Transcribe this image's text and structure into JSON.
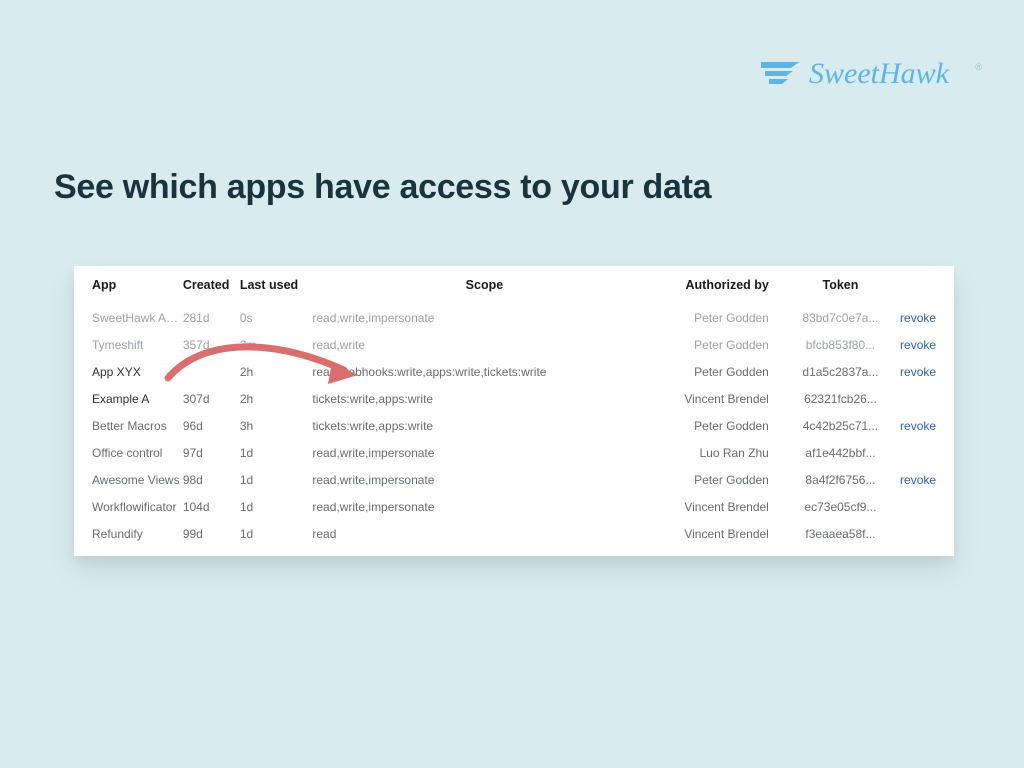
{
  "brand": {
    "name": "SweetHawk"
  },
  "headline": "See which apps have access to your data",
  "table": {
    "headers": {
      "app": "App",
      "created": "Created",
      "last_used": "Last used",
      "scope": "Scope",
      "authorized_by": "Authorized by",
      "token": "Token"
    },
    "revoke_label": "revoke",
    "rows": [
      {
        "app": "SweetHawk Apps",
        "created": "281d",
        "last_used": "0s",
        "scope": "read,write,impersonate",
        "authorized_by": "Peter Godden",
        "token": "83bd7c0e7a...",
        "revoke": true
      },
      {
        "app": "Tymeshift",
        "created": "357d",
        "last_used": "3m",
        "scope": "read,write",
        "authorized_by": "Peter Godden",
        "token": "bfcb853f80...",
        "revoke": true
      },
      {
        "app": "App XYX",
        "created": "",
        "last_used": "2h",
        "scope": "read,webhooks:write,apps:write,tickets:write",
        "authorized_by": "Peter Godden",
        "token": "d1a5c2837a...",
        "revoke": true
      },
      {
        "app": "Example A",
        "created": "307d",
        "last_used": "2h",
        "scope": "tickets:write,apps:write",
        "authorized_by": "Vincent Brendel",
        "token": "62321fcb26...",
        "revoke": false
      },
      {
        "app": "Better Macros",
        "created": "96d",
        "last_used": "3h",
        "scope": "tickets:write,apps:write",
        "authorized_by": "Peter Godden",
        "token": "4c42b25c71...",
        "revoke": true
      },
      {
        "app": "Office control",
        "created": "97d",
        "last_used": "1d",
        "scope": "read,write,impersonate",
        "authorized_by": "Luo Ran Zhu",
        "token": "af1e442bbf...",
        "revoke": false
      },
      {
        "app": "Awesome Views",
        "created": "98d",
        "last_used": "1d",
        "scope": "read,write,impersonate",
        "authorized_by": "Peter Godden",
        "token": "8a4f2f6756...",
        "revoke": true
      },
      {
        "app": "Workflowificator",
        "created": "104d",
        "last_used": "1d",
        "scope": "read,write,impersonate",
        "authorized_by": "Vincent Brendel",
        "token": "ec73e05cf9...",
        "revoke": false
      },
      {
        "app": "Refundify",
        "created": "99d",
        "last_used": "1d",
        "scope": "read",
        "authorized_by": "Vincent Brendel",
        "token": "f3eaaea58f...",
        "revoke": false
      }
    ]
  }
}
